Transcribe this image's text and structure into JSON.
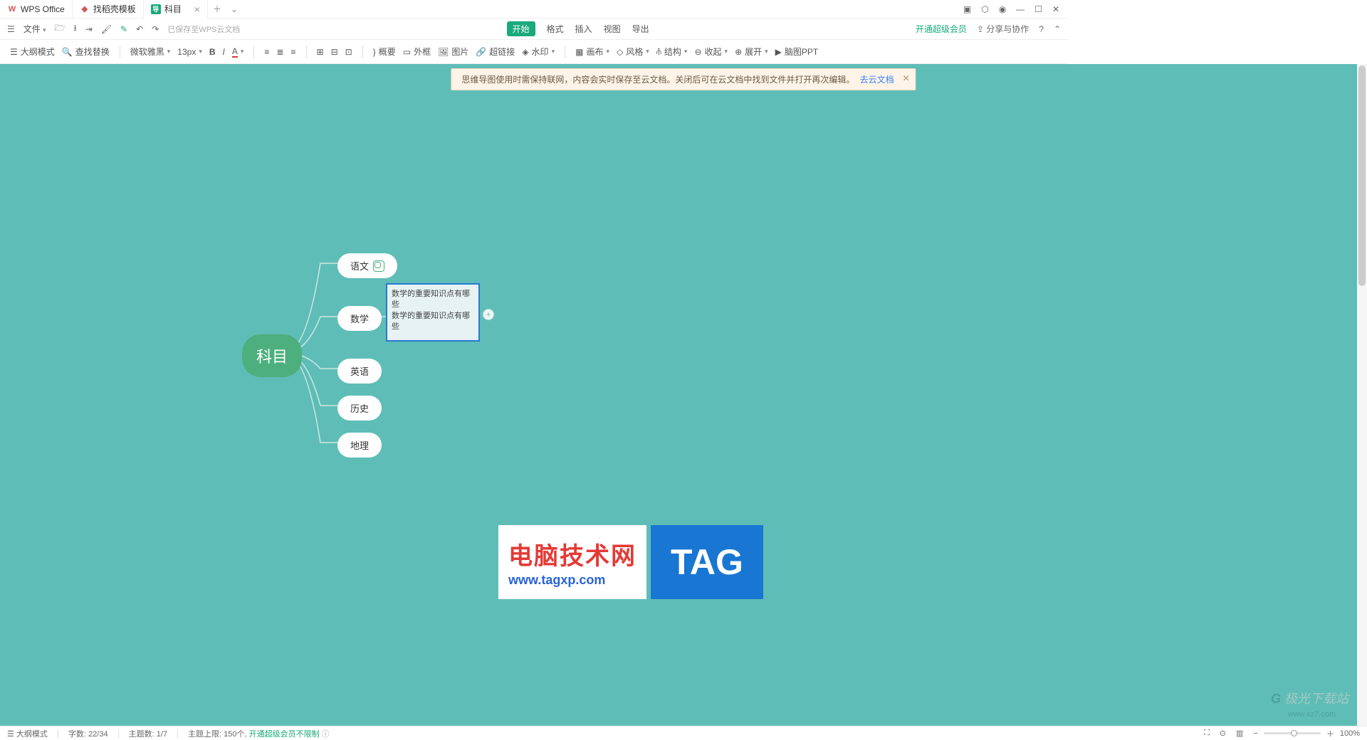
{
  "tabs": {
    "wps": "WPS Office",
    "templates": "找稻壳模板",
    "doc": "科目"
  },
  "menubar": {
    "file": "文件",
    "saved": "已保存至WPS云文档",
    "start": "开始",
    "format": "格式",
    "insert": "插入",
    "view": "视图",
    "export": "导出",
    "vip": "开通超级会员",
    "share": "分享与协作"
  },
  "ribbon": {
    "outline": "大纲模式",
    "find": "查找替换",
    "font": "微软雅黑",
    "size": "13px",
    "summary": "概要",
    "frame": "外框",
    "image": "图片",
    "link": "超链接",
    "watermark": "水印",
    "canvas": "画布",
    "style": "风格",
    "structure": "结构",
    "collapse": "收起",
    "expand": "展开",
    "ppt": "脑图PPT"
  },
  "notice": {
    "text": "思维导图使用时需保持联网，内容会实时保存至云文档。关闭后可在云文档中找到文件并打开再次编辑。",
    "link": "去云文档"
  },
  "mind": {
    "root": "科目",
    "c1": "语文",
    "c2": "数学",
    "c3": "英语",
    "c4": "历史",
    "c5": "地理",
    "note1": "数学的重要知识点有哪些",
    "note2": "数学的重要知识点有哪些"
  },
  "banner": {
    "t1": "电脑技术网",
    "t2": "www.tagxp.com",
    "tag": "TAG"
  },
  "watermark": {
    "brand": "极光下载站",
    "url": "www.xz7.com"
  },
  "status": {
    "outline": "大纲模式",
    "words_label": "字数:",
    "words": "22/34",
    "topics_label": "主题数:",
    "topics": "1/7",
    "limit_label": "主题上限:",
    "limit": "150个,",
    "vip": "开通超级会员不限制",
    "zoom": "100%"
  }
}
